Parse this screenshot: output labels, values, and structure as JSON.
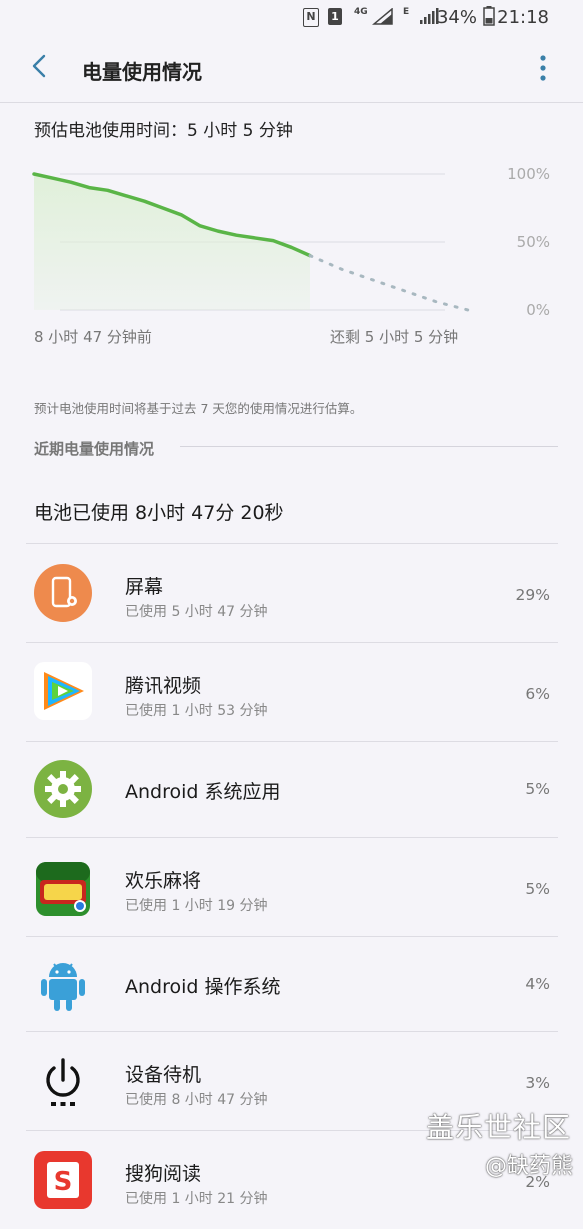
{
  "status_bar": {
    "battery_pct": "34%",
    "time": "21:18",
    "net_label": "4G",
    "sim_label": "1",
    "nfc_label": "N",
    "edge_label": "E"
  },
  "app_bar": {
    "title": "电量使用情况"
  },
  "estimate": {
    "text": "预估电池使用时间：5 小时 5 分钟"
  },
  "chart_data": {
    "type": "line",
    "series": [
      {
        "values": [
          100,
          97,
          94,
          90,
          88,
          84,
          80,
          75,
          70,
          62,
          58,
          55,
          53,
          51,
          46,
          40
        ]
      },
      {
        "values": [
          40,
          30,
          22,
          14,
          6,
          0
        ]
      }
    ],
    "y_ticks": [
      "100%",
      "50%",
      "0%"
    ],
    "x_start_label": "8 小时 47 分钟前",
    "x_end_label": "还剩 5 小时 5 分钟",
    "colors": {
      "history": "#5ab547",
      "projection": "#a8b8c0",
      "fill": "#dff0d8"
    }
  },
  "note": "预计电池使用时间将基于过去 7 天您的使用情况进行估算。",
  "section_title": "近期电量使用情况",
  "battery_used": "电池已使用 8小时 47分 20秒",
  "apps": [
    {
      "name": "屏幕",
      "sub": "已使用 5 小时 47 分钟",
      "pct": "29%",
      "icon": "screen-icon"
    },
    {
      "name": "腾讯视频",
      "sub": "已使用 1 小时 53 分钟",
      "pct": "6%",
      "icon": "tencent-video-icon"
    },
    {
      "name": "Android 系统应用",
      "sub": "",
      "pct": "5%",
      "icon": "android-system-apps-icon"
    },
    {
      "name": "欢乐麻将",
      "sub": "已使用 1 小时 19 分钟",
      "pct": "5%",
      "icon": "mahjong-game-icon"
    },
    {
      "name": "Android 操作系统",
      "sub": "",
      "pct": "4%",
      "icon": "android-os-icon"
    },
    {
      "name": "设备待机",
      "sub": "已使用 8 小时 47 分钟",
      "pct": "3%",
      "icon": "standby-power-icon"
    },
    {
      "name": "搜狗阅读",
      "sub": "已使用 1 小时 21 分钟",
      "pct": "2%",
      "icon": "sogou-reader-icon"
    }
  ],
  "watermark": {
    "line1": "盖乐世社区",
    "line2": "@缺药熊"
  }
}
